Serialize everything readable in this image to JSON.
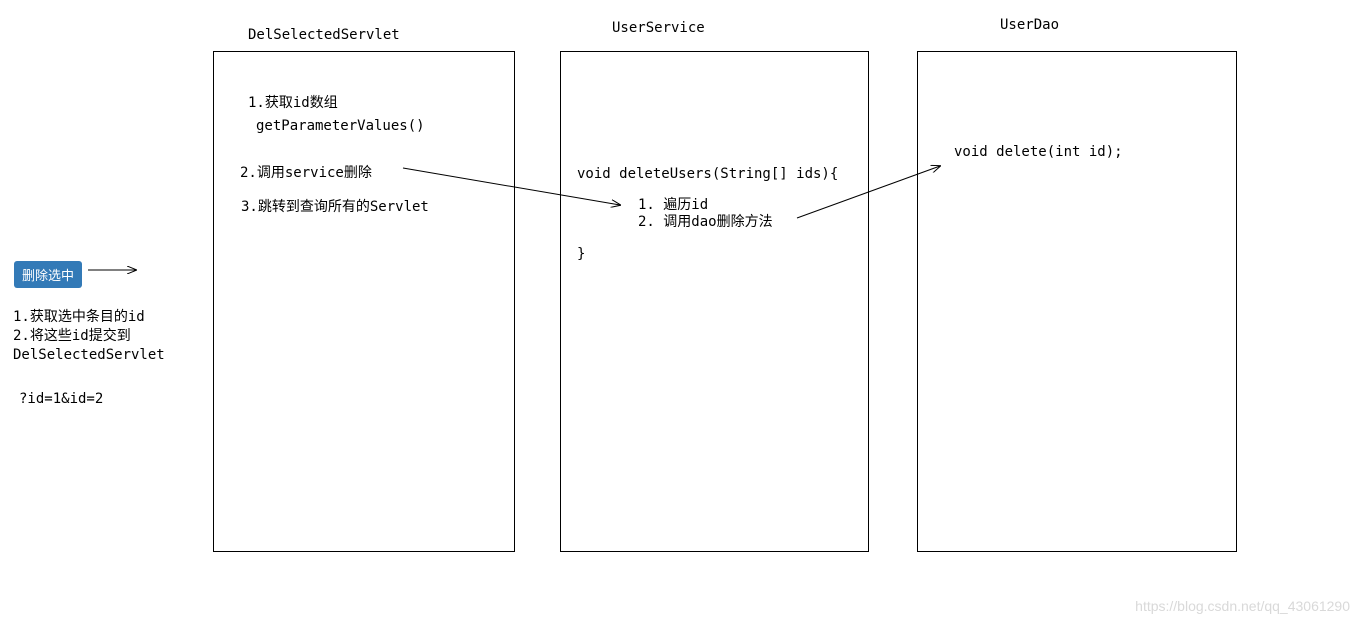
{
  "titles": {
    "servlet": "DelSelectedServlet",
    "service": "UserService",
    "dao": "UserDao"
  },
  "servlet_box": {
    "line1": "1.获取id数组",
    "line2": "getParameterValues()",
    "line3": "2.调用service删除",
    "line4": "3.跳转到查询所有的Servlet"
  },
  "service_box": {
    "sig": "void deleteUsers(String[] ids){",
    "step1": "1. 遍历id",
    "step2": "2. 调用dao删除方法",
    "close": "}"
  },
  "dao_box": {
    "sig": "void delete(int id);"
  },
  "button": {
    "label": "删除选中"
  },
  "side": {
    "l1": "1.获取选中条目的id",
    "l2": "2.将这些id提交到",
    "l3": "DelSelectedServlet",
    "q": "?id=1&id=2"
  },
  "watermark": "https://blog.csdn.net/qq_43061290"
}
